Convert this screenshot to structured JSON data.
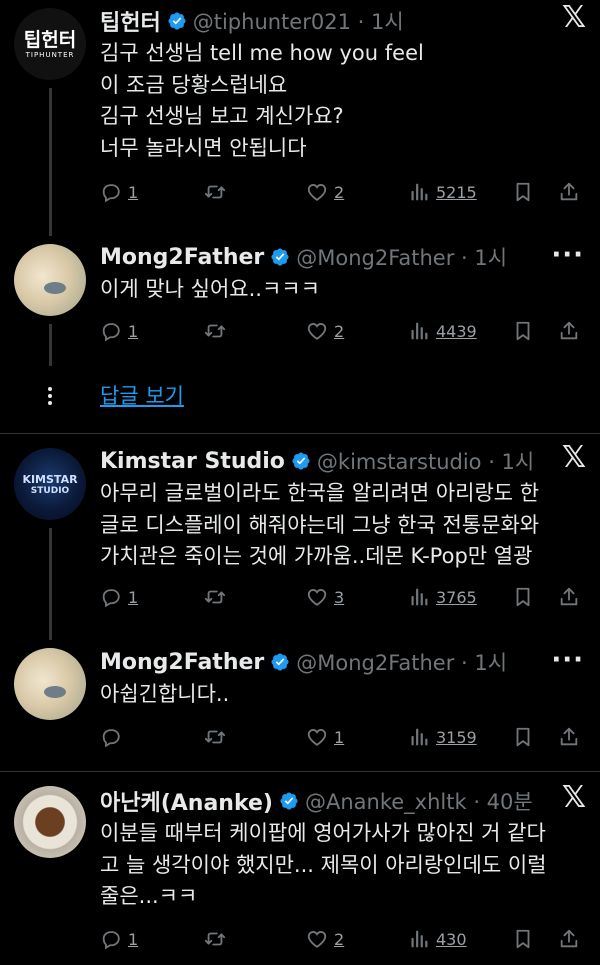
{
  "tweets": [
    {
      "name": "팁헌터",
      "handle": "@tiphunter021 · 1시",
      "avatar_text": "팁헌터",
      "avatar_sub": "TIPHUNTER",
      "lines": [
        "김구 선생님 tell me how you feel",
        "이 조금 당황스럽네요",
        "김구 선생님 보고 계신가요?",
        "너무 놀라시면 안됩니다"
      ],
      "replies": "1",
      "retweets": "",
      "likes": "2",
      "views": "5215"
    },
    {
      "name": "Mong2Father",
      "handle": "@Mong2Father · 1시",
      "lines": [
        "이게 맞나 싶어요..ㅋㅋㅋ"
      ],
      "replies": "1",
      "retweets": "",
      "likes": "2",
      "views": "4439"
    },
    {
      "name": "Kimstar Studio",
      "handle": "@kimstarstudio · 1시",
      "avatar_text": "KIMSTAR",
      "avatar_sub": "STUDIO",
      "lines": [
        "아무리 글로벌이라도 한국을 알리려면 아리랑도 한",
        "글로 디스플레이 해줘야는데 그냥 한국 전통문화와",
        "가치관은 죽이는 것에 가까움..데몬 K-Pop만 열광"
      ],
      "replies": "1",
      "retweets": "",
      "likes": "3",
      "views": "3765"
    },
    {
      "name": "Mong2Father",
      "handle": "@Mong2Father · 1시",
      "lines": [
        "아쉽긴합니다.."
      ],
      "replies": "",
      "retweets": "",
      "likes": "1",
      "views": "3159"
    },
    {
      "name": "아난케(Ananke)",
      "handle": "@Ananke_xhltk · 40분",
      "lines": [
        "이분들 때부터 케이팝에 영어가사가 많아진 거 같다",
        "고 늘 생각이야 했지만... 제목이 아리랑인데도 이럴",
        "줄은...ㅋㅋ"
      ],
      "replies": "1",
      "retweets": "",
      "likes": "2",
      "views": "430"
    }
  ],
  "show_replies_label": "답글 보기",
  "icons": {
    "verified": "verified-badge-icon",
    "x": "x-logo-icon",
    "more": "more-icon",
    "reply": "reply-icon",
    "retweet": "retweet-icon",
    "like": "like-icon",
    "views": "views-icon",
    "bookmark": "bookmark-icon",
    "share": "share-icon"
  },
  "colors": {
    "background": "#000000",
    "text": "#e7e9ea",
    "muted": "#71767b",
    "accent": "#1d9bf0"
  },
  "x_glyph": "𝕏",
  "more_glyph": "···"
}
